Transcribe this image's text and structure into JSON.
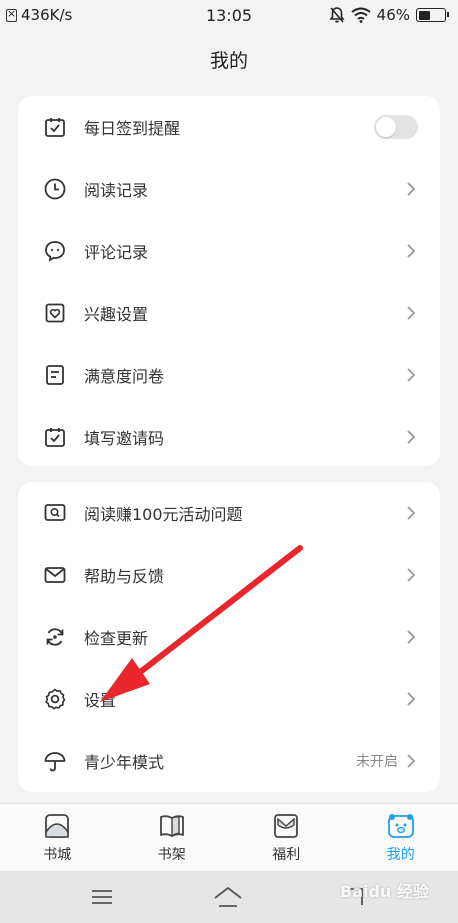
{
  "status_bar": {
    "speed": "436K/s",
    "time": "13:05",
    "battery": "46%",
    "battery_level": 0.46
  },
  "header": {
    "title": "我的"
  },
  "group1": [
    {
      "label": "每日签到提醒",
      "icon": "calendar-check-icon",
      "control": "toggle",
      "toggle_on": false
    },
    {
      "label": "阅读记录",
      "icon": "clock-icon"
    },
    {
      "label": "评论记录",
      "icon": "chat-bubble-icon"
    },
    {
      "label": "兴趣设置",
      "icon": "heart-box-icon"
    },
    {
      "label": "满意度问卷",
      "icon": "document-icon"
    },
    {
      "label": "填写邀请码",
      "icon": "calendar-check-icon"
    }
  ],
  "group2": [
    {
      "label": "阅读赚100元活动问题",
      "icon": "search-screen-icon"
    },
    {
      "label": "帮助与反馈",
      "icon": "mail-icon"
    },
    {
      "label": "检查更新",
      "icon": "refresh-icon"
    },
    {
      "label": "设置",
      "icon": "gear-icon"
    },
    {
      "label": "青少年模式",
      "icon": "umbrella-icon",
      "value": "未开启"
    }
  ],
  "bottom_nav": [
    {
      "label": "书城",
      "icon": "home-icon",
      "active": false
    },
    {
      "label": "书架",
      "icon": "book-icon",
      "active": false
    },
    {
      "label": "福利",
      "icon": "envelope-icon",
      "active": false
    },
    {
      "label": "我的",
      "icon": "bear-face-icon",
      "active": true
    }
  ],
  "colors": {
    "accent": "#1fa1e8",
    "annotation_arrow": "#e8262b"
  },
  "watermark": "Baidu 经验"
}
